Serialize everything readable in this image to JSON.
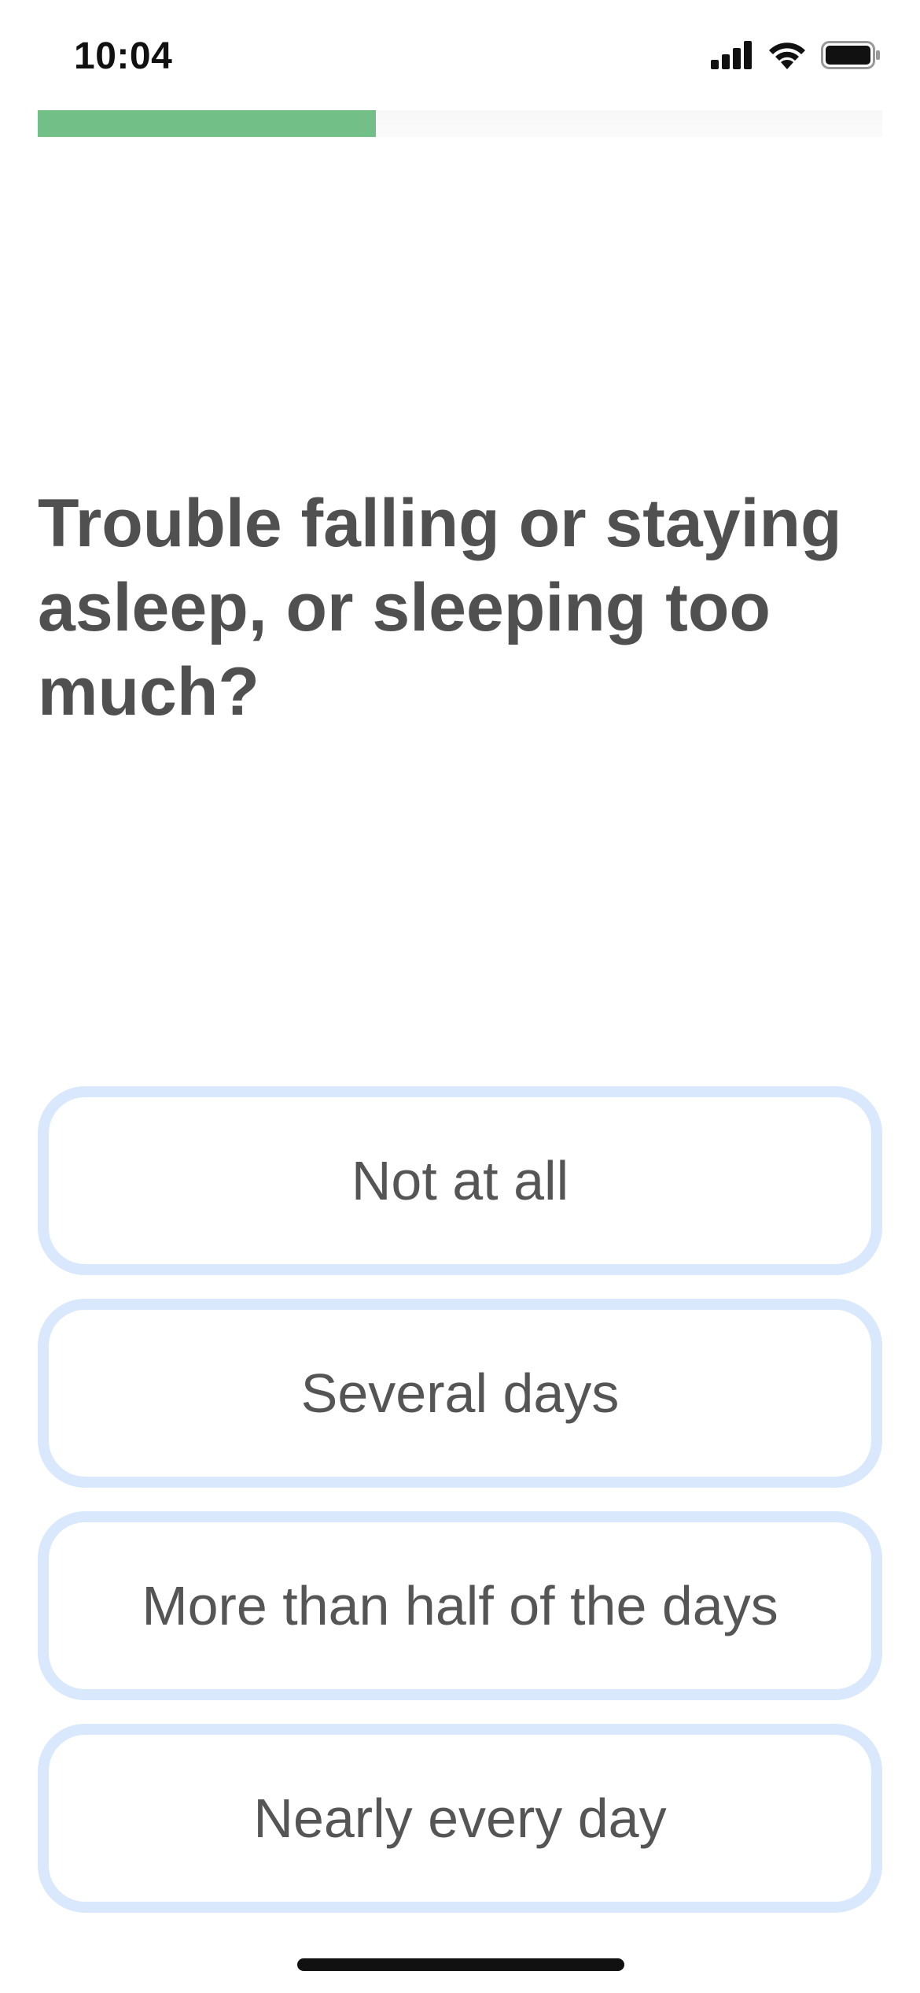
{
  "status_bar": {
    "time": "10:04",
    "icons": [
      "cellular-signal-icon",
      "wifi-icon",
      "battery-icon"
    ]
  },
  "progress": {
    "fraction": 0.4,
    "fill_color": "#72bf88",
    "track_color": "#f7f7f7"
  },
  "question": {
    "text": "Trouble falling or staying asleep, or sleeping too much?"
  },
  "options": [
    {
      "label": "Not at all"
    },
    {
      "label": "Several days"
    },
    {
      "label": "More than half of the days"
    },
    {
      "label": "Nearly every day"
    }
  ],
  "colors": {
    "option_border": "#d9e8fc",
    "text": "#505050"
  }
}
